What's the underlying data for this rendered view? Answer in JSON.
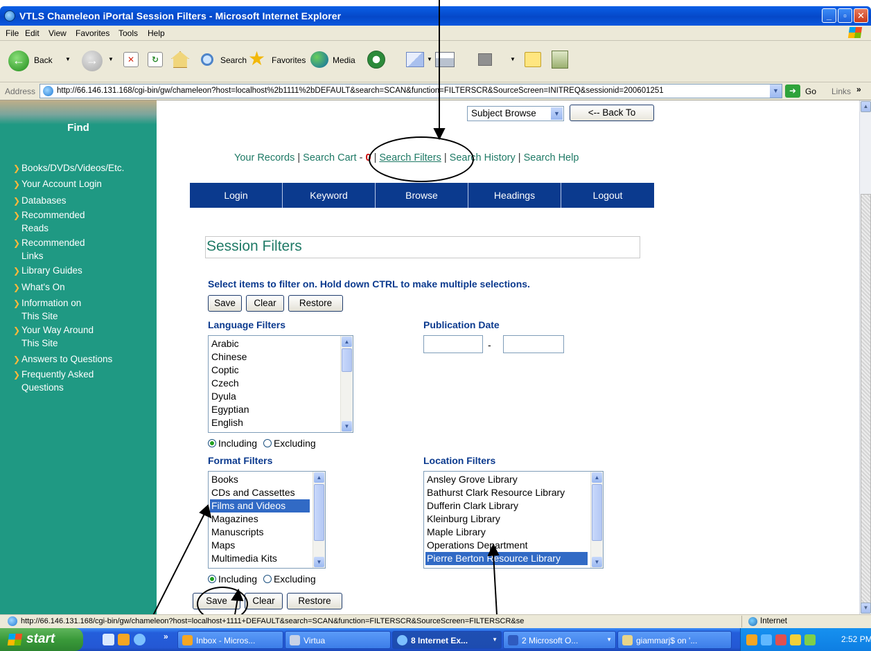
{
  "window": {
    "title": "VTLS Chameleon iPortal Session Filters - Microsoft Internet Explorer",
    "min": "_",
    "max": "▫",
    "close": "✕"
  },
  "menu": [
    "File",
    "Edit",
    "View",
    "Favorites",
    "Tools",
    "Help"
  ],
  "toolbar": {
    "back": "Back",
    "search": "Search",
    "favorites": "Favorites",
    "media": "Media"
  },
  "address": {
    "label": "Address",
    "url": "http://66.146.131.168/cgi-bin/gw/chameleon?host=localhost%2b1111%2bDEFAULT&search=SCAN&function=FILTERSCR&SourceScreen=INITREQ&sessionid=200601251",
    "go": "Go",
    "links": "Links",
    "more": "»"
  },
  "sidebar": {
    "find": "Find",
    "items": [
      "Books/DVDs/Videos/Etc.",
      "Your Account Login",
      "Databases",
      "Recommended",
      "Reads",
      "Recommended",
      "Links",
      "Library Guides",
      "What's On",
      "Information on",
      "This Site",
      "Your Way Around",
      "This Site",
      "Answers to Questions",
      "Frequently Asked",
      "Questions"
    ]
  },
  "header": {
    "browse_select": "Subject Browse",
    "back_to": "<-- Back To"
  },
  "toplinks": {
    "your_records": "Your Records",
    "search_cart": "Search Cart",
    "cart_dash": "-",
    "cart_count": "0",
    "search_filters": "Search Filters",
    "search_history": "Search History",
    "search_help": "Search Help",
    "sep": "|"
  },
  "nav": [
    "Login",
    "Keyword",
    "Browse",
    "Headings",
    "Logout"
  ],
  "filters": {
    "title": "Session Filters",
    "instructions": "Select items to filter on. Hold down CTRL to make multiple selections.",
    "save": "Save",
    "clear": "Clear",
    "restore": "Restore",
    "language_label": "Language Filters",
    "languages": [
      "Arabic",
      "Chinese",
      "Coptic",
      "Czech",
      "Dyula",
      "Egyptian",
      "English"
    ],
    "pubdate_label": "Publication Date",
    "pubdate_from": "",
    "pubdate_to": "",
    "pubdate_sep": "-",
    "including": "Including",
    "excluding": "Excluding",
    "format_label": "Format Filters",
    "formats": [
      "Books",
      "CDs and Cassettes",
      "Films and Videos",
      "Magazines",
      "Manuscripts",
      "Maps",
      "Multimedia Kits"
    ],
    "format_selected": "Films and Videos",
    "location_label": "Location Filters",
    "locations": [
      "Ansley Grove Library",
      "Bathurst Clark Resource Library",
      "Dufferin Clark Library",
      "Kleinburg Library",
      "Maple Library",
      "Operations Department",
      "Pierre Berton Resource Library"
    ],
    "location_selected": "Pierre Berton Resource Library",
    "bottom_save": "Save",
    "bottom_clear": "Clear",
    "bottom_restore": "Restore"
  },
  "status": {
    "text": "http://66.146.131.168/cgi-bin/gw/chameleon?host=localhost+1111+DEFAULT&search=SCAN&function=FILTERSCR&SourceScreen=FILTERSCR&se",
    "zone": "Internet"
  },
  "taskbar": {
    "start": "start",
    "chevron": "»",
    "tasks": [
      "Inbox - Micros...",
      "Virtua",
      "8 Internet Ex...",
      "2 Microsoft O...",
      "giammarj$ on '..."
    ],
    "clock": "2:52 PM"
  },
  "colors": {
    "sidebar": "#1f9983",
    "nav": "#0b3a8e",
    "link": "#1f7a66",
    "selection": "#316ac5"
  }
}
